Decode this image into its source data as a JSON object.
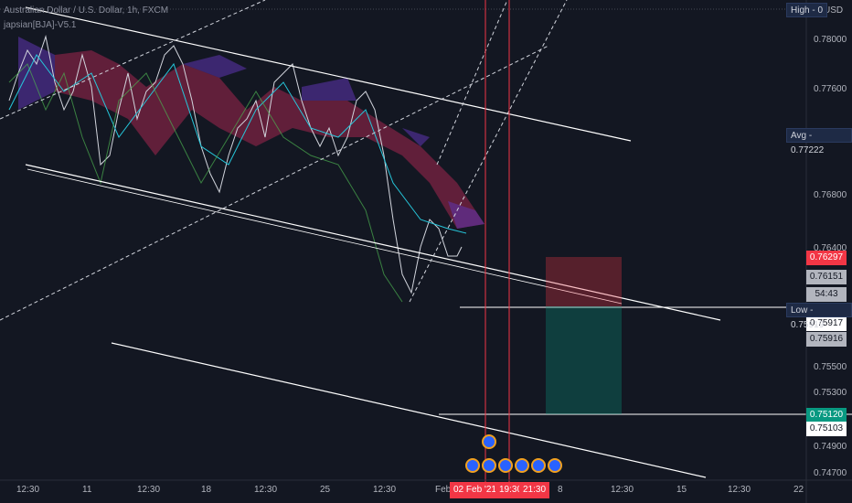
{
  "header": {
    "symbol": "Australian Dollar / U.S. Dollar, 1h, FXCM",
    "indicator": "japsian[BJA]-V5.1"
  },
  "currency": "USD",
  "y_axis_ticks": [
    "0.78000",
    "0.77600",
    "0.76800",
    "0.76400",
    "0.75500",
    "0.75300",
    "0.74900",
    "0.74700"
  ],
  "price_tags": [
    {
      "value": "0.76297",
      "bg": "#f23645",
      "fg": "#ffffff",
      "name": "stop-loss-price-tag"
    },
    {
      "value": "0.76151",
      "bg": "#b2b5be",
      "fg": "#131722",
      "name": "entry-price-tag"
    },
    {
      "value": "54:43",
      "bg": "#b2b5be",
      "fg": "#131722",
      "name": "countdown-tag"
    },
    {
      "value": "0.75917",
      "bg": "#ffffff",
      "fg": "#131722",
      "name": "current-price-tag"
    },
    {
      "value": "0.75916",
      "bg": "#b2b5be",
      "fg": "#131722",
      "name": "last-price-tag"
    },
    {
      "value": "0.75120",
      "bg": "#089981",
      "fg": "#ffffff",
      "name": "take-profit-price-tag"
    },
    {
      "value": "0.75103",
      "bg": "#ffffff",
      "fg": "#131722",
      "name": "low-line-price-tag"
    }
  ],
  "side_labels": {
    "high": "High - 0",
    "avg": "Avg - 0.77222",
    "low": "Low - 0.75919"
  },
  "x_axis": {
    "labels": [
      "12:30",
      "11",
      "12:30",
      "18",
      "12:30",
      "25",
      "12:30",
      "Feb",
      "8",
      "12:30",
      "15",
      "12:30",
      "22"
    ],
    "highlight": [
      "02 Feb '21",
      "19:30",
      "21:30"
    ]
  },
  "colors": {
    "background": "#131722",
    "bear_cloud": "#c2185b",
    "bull_cloud": "#5e35b1",
    "stop_zone": "#f23645",
    "target_zone": "#089981",
    "vertical_marker": "#f23645"
  }
}
